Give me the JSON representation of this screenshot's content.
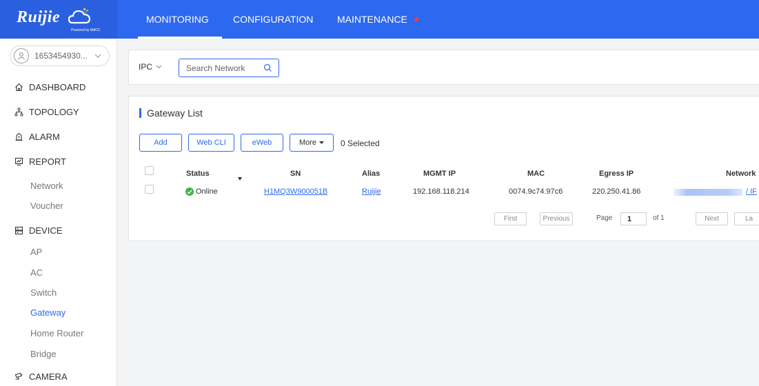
{
  "brand": {
    "name": "Ruijie",
    "tagline": "Powered by MACC"
  },
  "top_nav": {
    "items": [
      {
        "label": "MONITORING",
        "active": true
      },
      {
        "label": "CONFIGURATION",
        "active": false
      },
      {
        "label": "MAINTENANCE",
        "active": false,
        "has_dot": true
      }
    ]
  },
  "sidebar": {
    "user": "1653454930...",
    "menu": [
      {
        "label": "DASHBOARD",
        "icon": "home-icon"
      },
      {
        "label": "TOPOLOGY",
        "icon": "topology-icon"
      },
      {
        "label": "ALARM",
        "icon": "alarm-icon"
      },
      {
        "label": "REPORT",
        "icon": "report-icon"
      },
      {
        "label": "Network"
      },
      {
        "label": "Voucher"
      },
      {
        "label": "DEVICE",
        "icon": "device-icon"
      },
      {
        "label": "AP"
      },
      {
        "label": "AC"
      },
      {
        "label": "Switch"
      },
      {
        "label": "Gateway",
        "active": true
      },
      {
        "label": "Home Router"
      },
      {
        "label": "Bridge"
      },
      {
        "label": "CAMERA",
        "icon": "camera-icon"
      }
    ]
  },
  "filter": {
    "type_select": "IPC",
    "search_placeholder": "Search Network"
  },
  "gateway_list": {
    "title": "Gateway List",
    "buttons": {
      "add": "Add",
      "web_cli": "Web CLI",
      "eweb": "eWeb",
      "more": "More"
    },
    "selected_text": "0 Selected",
    "columns": [
      "Status",
      "SN",
      "Alias",
      "MGMT IP",
      "MAC",
      "Egress IP",
      "Network"
    ],
    "rows": [
      {
        "status": "Online",
        "sn": "H1MQ3W900051B",
        "alias": "Ruijie",
        "mgmt_ip": "192.168.118.214",
        "mac": "0074.9c74.97c6",
        "egress_ip": "220.250.41.86",
        "network_suffix": "/ IF"
      }
    ],
    "pagination": {
      "first": "First",
      "previous": "Previous",
      "page_label": "Page",
      "page": "1",
      "of_label": "of 1",
      "next": "Next",
      "last": "La"
    }
  },
  "colors": {
    "primary": "#2d68f0",
    "online": "#3cb54a",
    "dot": "#ff3b30"
  }
}
